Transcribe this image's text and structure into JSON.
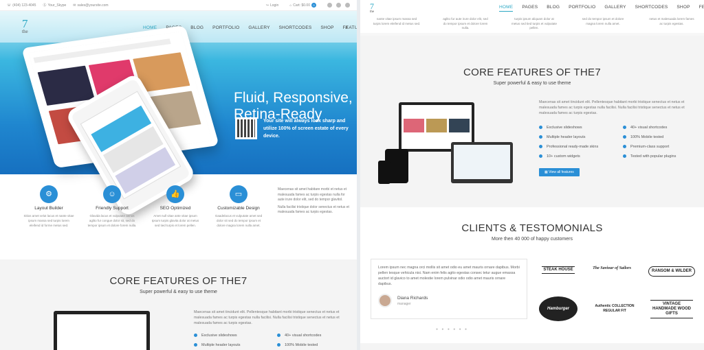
{
  "left": {
    "topbar": {
      "phone": "(404) 123-4045",
      "skype": "Your_Skype",
      "email": "sales@yoursite.com",
      "login": "Login",
      "cart": "Cart: $0.00",
      "cart_count": "0"
    },
    "logo": {
      "number": "7",
      "text": "the"
    },
    "nav": [
      "HOME",
      "PAGES",
      "BLOG",
      "PORTFOLIO",
      "GALLERY",
      "SHORTCODES",
      "SHOP",
      "FEATURES"
    ],
    "hero": {
      "title_line1": "Fluid, Responsive,",
      "title_line2": "Retina-Ready",
      "subtitle": "Your site will always look sharp and utilize 100% of screen estate of every device."
    },
    "features": [
      {
        "title": "Layout Builder",
        "desc": "Sitios amet velut lacus et nante vitae ipsum massa sed turpis lorem eleifend id forme metus sed."
      },
      {
        "title": "Friendly Support",
        "desc": "Glavida lacus et vulputate annos aglito fur congue dolor sit, sed do tempor ipsum et dolore forem nulla."
      },
      {
        "title": "SEO Optimized",
        "desc": "Amet null vitae ante vitae ipsum Ipsum turpis glavita dolor at metus sed tied turpis et lorem pellen."
      },
      {
        "title": "Customizable Design",
        "desc": "Gaadelacus et vulputate amet sed dolor sit sed do tempor ipsum et dolore magna lorem nulla amet."
      }
    ],
    "side_text": [
      "Maecenas sit amet habitare morbi et netus et malesuada fames ac turpis egestas nulla for aute irure dolor elit, sed do tempor glavitol.",
      "Nulla facilisi tristique dolor senectus et netus et malesuada fames ac turpis egestas."
    ],
    "core": {
      "title": "CORE FEATURES OF THE7",
      "subtitle": "Super powerful & easy to use theme",
      "para": "Maecenas sit amet tincidunt elit. Pellentesque habitant morbi tristique senectus et netus et malesuada fames ac turpis egestas nulla facilisi. Nulla facilisi tristique senectus et netus et malesuada fames ac turpis egestas.",
      "bullets": [
        "Exclusive slideshows",
        "40+ visual shortcodes",
        "Multiple header layouts",
        "100% Mobile tested"
      ]
    }
  },
  "right": {
    "nav": [
      "HOME",
      "PAGES",
      "BLOG",
      "PORTFOLIO",
      "GALLERY",
      "SHORTCODES",
      "SHOP",
      "FEATURES"
    ],
    "logo": {
      "number": "7",
      "text": "the"
    },
    "top_cols": [
      "nante vitae ipsum massa sed turpis lorem eleifend id metus sed.",
      "aglito fur aute irure dolor elit, sed do tempor ipsum et dolore lorem nulla.",
      "turpis ipsum aliquam dolor at metus sed tied turpis et vulputate pellen.",
      "sed do tempor ipsum et dolore magna lorem nulla amet.",
      "netus et malesuada lorem fames ac turpis egestas."
    ],
    "core": {
      "title": "CORE FEATURES OF THE7",
      "subtitle": "Super powerful & easy to use theme",
      "para": "Maecenas sit amet tincidunt elit. Pellentesque habitant morbi tristique senectus et netus et malesuada fames ac turpis egestas nulla facilisi. Nulla facilisi tristique senectus et netus et malesuada fames ac turpis egestas.",
      "bullets_left": [
        "Exclusive slideshows",
        "Multiple header layouts",
        "Professional ready-made skins",
        "10+ custom widgets"
      ],
      "bullets_right": [
        "40+ visual shortcodes",
        "100% Mobile tested",
        "Premium-class support",
        "Tested with popular plugins"
      ],
      "button": "View all features"
    },
    "clients": {
      "title": "CLIENTS & TESTOMONIALS",
      "subtitle": "More then 40 000 of happy customers"
    },
    "testimonial": {
      "text": "Lorem ipsum nec magna orci mollis sit amet odio eu amet mauris ornare dapibus. Morbi pellen tesque vehicula nisi. Nam enim felis agito egestas consec tetur augue emassa auctort id glavico to amet molestie lorem pulvinar odio odio amet mauris ornare dapibus.",
      "name": "Diana Richards",
      "role": "manager"
    },
    "logos": [
      "STEAK HOUSE",
      "The Saviour of Sailors",
      "RANSOM & WILDER",
      "Hamburger",
      "Authentic COLLECTION REGULAR FIT",
      "VINTAGE HANDMADE WOOD GIFTS"
    ]
  }
}
